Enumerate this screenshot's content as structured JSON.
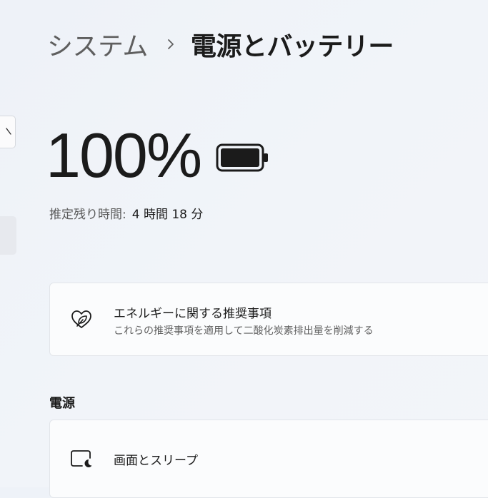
{
  "breadcrumb": {
    "parent": "システム",
    "current": "電源とバッテリー"
  },
  "battery": {
    "percent_text": "100%",
    "level": 1.0,
    "remaining_label": "推定残り時間:",
    "remaining_value": "4 時間 18 分"
  },
  "recommendations": {
    "title": "エネルギーに関する推奨事項",
    "description": "これらの推奨事項を適用して二酸化炭素排出量を削減する",
    "icon": "leaf-heart-icon"
  },
  "power_section": {
    "heading": "電源",
    "items": [
      {
        "label": "画面とスリープ",
        "icon": "screen-sleep-icon"
      }
    ]
  },
  "colors": {
    "text_primary": "#1b1b1b",
    "text_secondary": "#5f5f5f",
    "card_bg": "#fbfcfd",
    "card_border": "#e2e5ea"
  }
}
